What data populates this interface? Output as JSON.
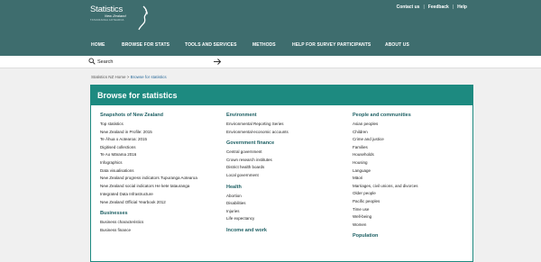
{
  "logo": {
    "title": "Statistics",
    "sub": "New Zealand",
    "sub2": "Tatauranga Aotearoa"
  },
  "utility": {
    "contact": "Contact us",
    "feedback": "Feedback",
    "help": "Help",
    "sep": "|"
  },
  "nav": {
    "items": [
      "HOME",
      "BROWSE FOR STATS",
      "TOOLS AND SERVICES",
      "METHODS",
      "HELP FOR SURVEY PARTICIPANTS",
      "ABOUT US"
    ]
  },
  "search": {
    "placeholder": "Search"
  },
  "breadcrumb": {
    "home": "Statistics NZ Home",
    "sep": " > ",
    "current": "Browse for statistics"
  },
  "panel": {
    "title": "Browse for statistics"
  },
  "columns": {
    "col1": {
      "groups": [
        {
          "heading": "Snapshots of New Zealand",
          "links": [
            "Top statistics",
            "New Zealand in Profile: 2015",
            "Te Āhua o Aotearoa: 2015",
            "Digitised collections",
            "Te Ao Mārama 2016",
            "Infographics",
            "Data visualisations",
            "New Zealand progress indicators Tupuranga Aotearoa",
            "New Zealand social indicators He kete tatauranga",
            "Integrated Data Infrastructure",
            "New Zealand Official Yearbook 2012"
          ]
        },
        {
          "heading": "Businesses",
          "links": [
            "Business characteristics",
            "Business finance"
          ]
        }
      ]
    },
    "col2": {
      "groups": [
        {
          "heading": "Environment",
          "links": [
            "Environmental Reporting Series",
            "Environmental-economic accounts"
          ]
        },
        {
          "heading": "Government finance",
          "links": [
            "Central government",
            "Crown research institutes",
            "District health boards",
            "Local government"
          ]
        },
        {
          "heading": "Health",
          "links": [
            "Abortion",
            "Disabilities",
            "Injuries",
            "Life expectancy"
          ]
        },
        {
          "heading": "Income and work",
          "links": []
        }
      ]
    },
    "col3": {
      "groups": [
        {
          "heading": "People and communities",
          "links": [
            "Asian peoples",
            "Children",
            "Crime and justice",
            "Families",
            "Households",
            "Housing",
            "Language",
            "Māori",
            "Marriages, civil unions, and divorces",
            "Older people",
            "Pacific peoples",
            "Time use",
            "Well-being",
            "Women"
          ]
        },
        {
          "heading": "Population",
          "links": []
        }
      ]
    }
  },
  "colors": {
    "header_bg": "#3e6d6e",
    "panel_accent": "#1d8a80",
    "heading": "#1d5f63"
  }
}
